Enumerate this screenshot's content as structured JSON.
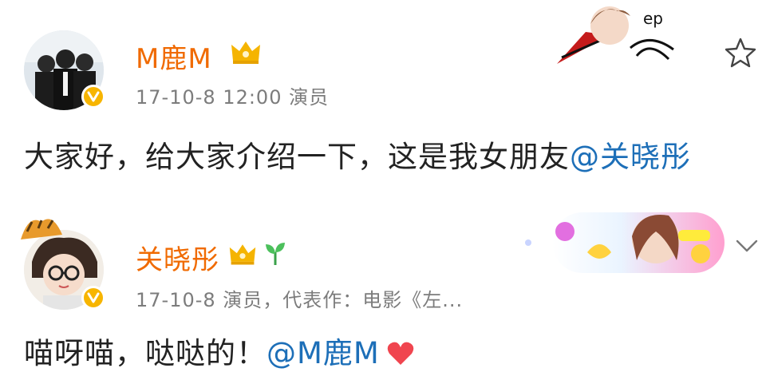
{
  "post1": {
    "user_name": "M鹿M",
    "meta": "17-10-8 12:00  演员",
    "content_text": "大家好，给大家介绍一下，这是我女朋友",
    "mention": "@关晓彤"
  },
  "post2": {
    "user_name": "关晓彤",
    "meta": "17-10-8  演员，代表作：电影《左...",
    "content_text": "喵呀喵，哒哒的！",
    "mention": "@M鹿M"
  },
  "icons": {
    "favorite": "star-icon",
    "verified": "verified-v-icon",
    "crown": "crown-icon",
    "sprout": "sprout-icon",
    "menu": "chevron-down-icon",
    "heart": "heart-icon"
  },
  "colors": {
    "name": "#f06a00",
    "meta": "#7c7c7c",
    "mention": "#1d6fb8",
    "verified": "#f7b500",
    "heart": "#f0454f"
  }
}
